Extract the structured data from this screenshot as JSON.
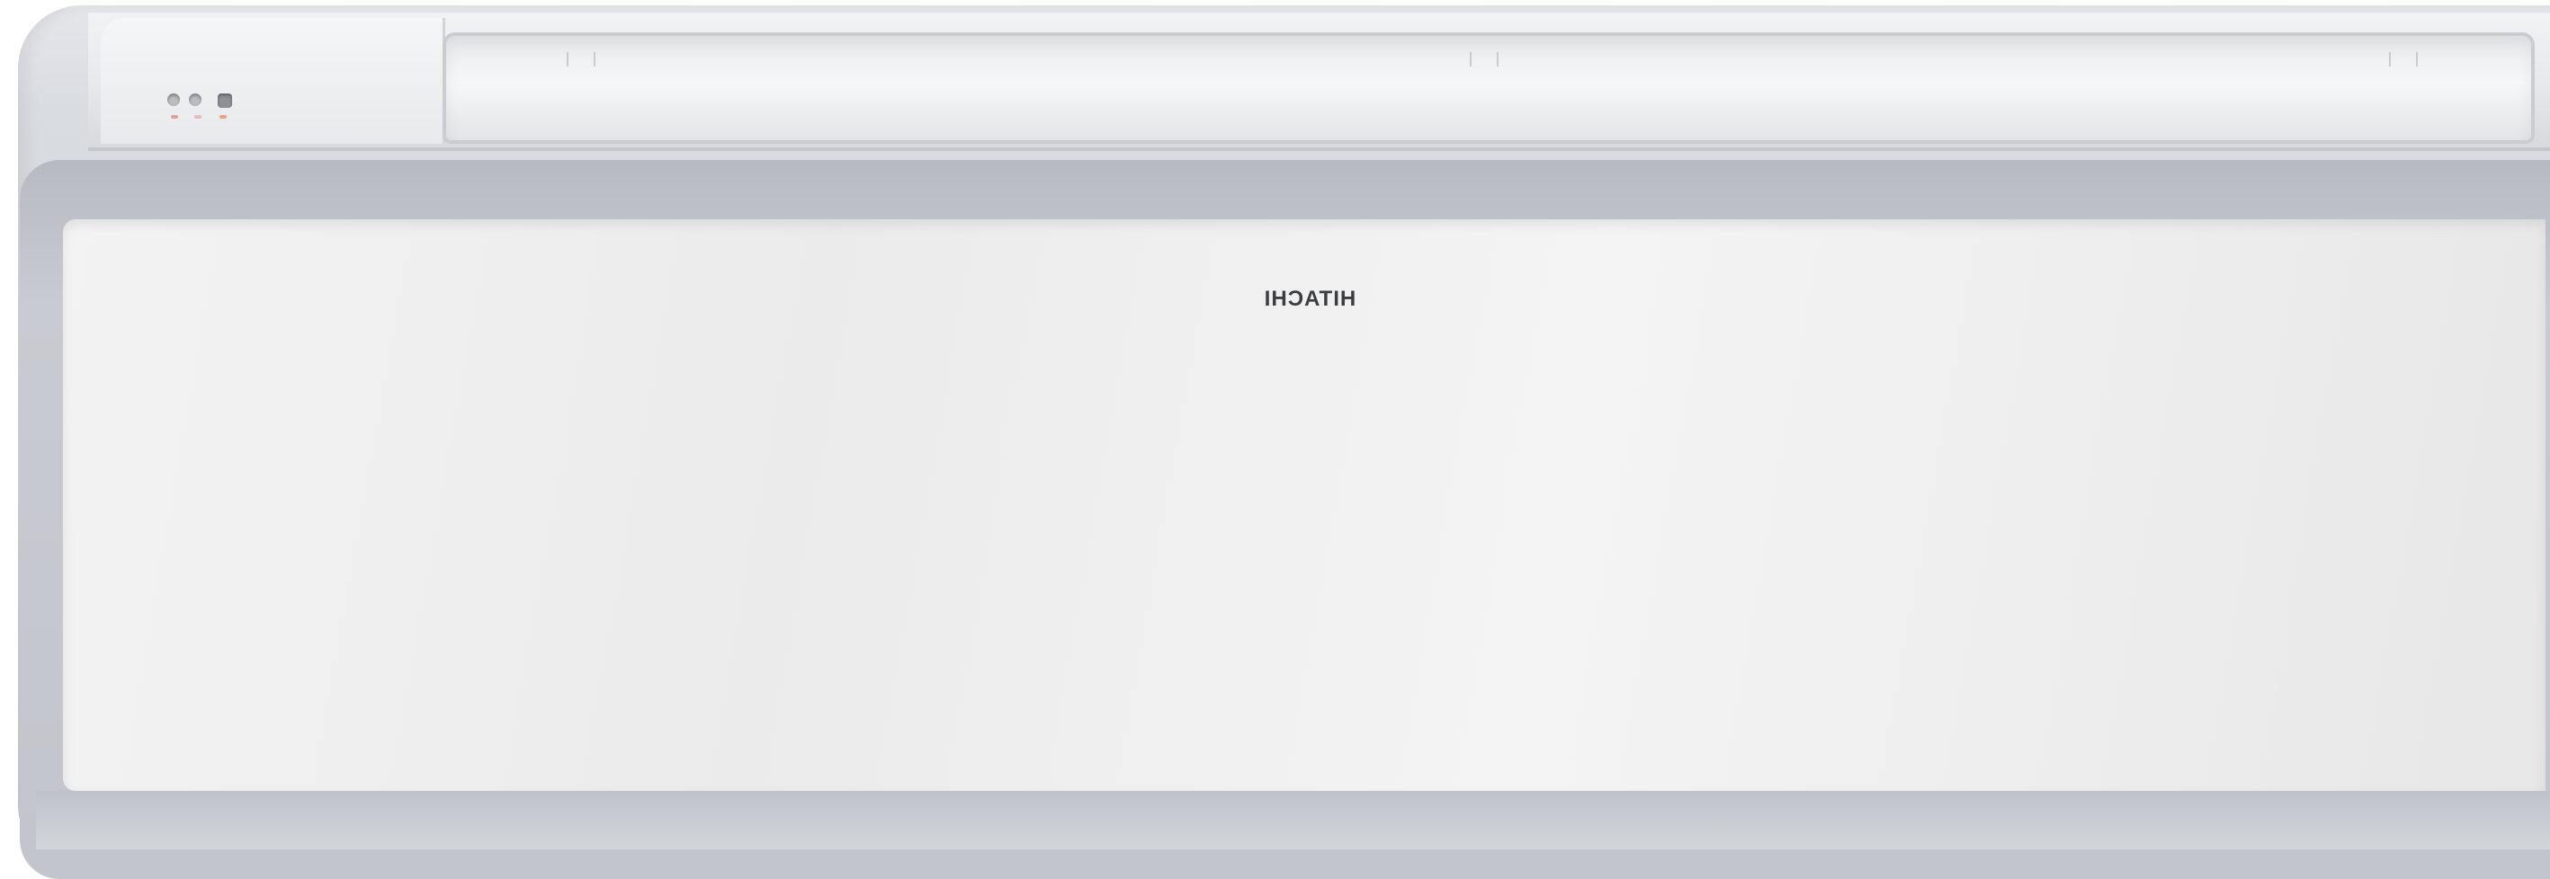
{
  "product": {
    "type": "wall-mounted air conditioner indoor unit",
    "brand_logo_text": "HITACHI",
    "status_panel_label": "",
    "indicator_lights": [
      "led-1",
      "led-2",
      "led-3"
    ]
  },
  "colors": {
    "body": "#d9dce1",
    "front_panel": "#efefef",
    "frame": "#c2c5cb",
    "logo": "#3b3d42"
  }
}
